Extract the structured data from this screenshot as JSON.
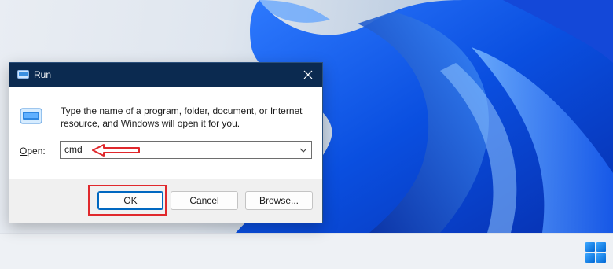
{
  "dialog": {
    "title": "Run",
    "description": "Type the name of a program, folder, document, or Internet resource, and Windows will open it for you.",
    "open_label": "Open:",
    "open_accel": "O",
    "open_rest": "pen:",
    "command_value": "cmd",
    "buttons": {
      "ok": "OK",
      "cancel": "Cancel",
      "browse": "Browse..."
    }
  },
  "colors": {
    "titlebar": "#0b2a50",
    "highlight": "#e0282c",
    "accent": "#0067c0"
  },
  "icons": {
    "title": "run-app-icon",
    "body": "run-app-icon",
    "close": "close-icon",
    "dropdown": "chevron-down-icon",
    "start": "windows-logo-icon"
  }
}
